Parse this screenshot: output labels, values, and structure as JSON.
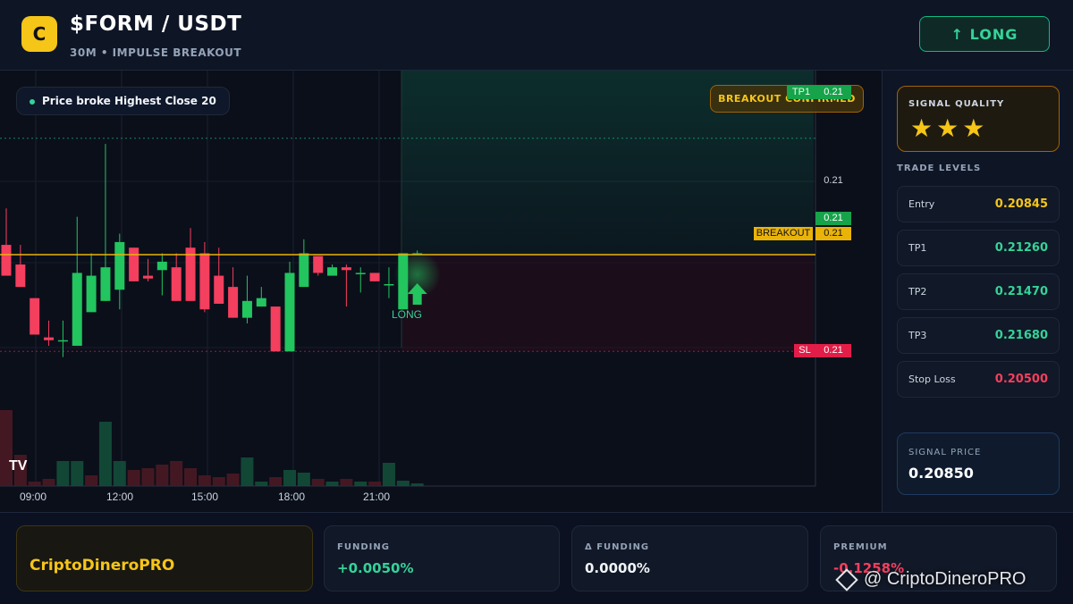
{
  "header": {
    "logo_letter": "C",
    "pair": "$FORM / USDT",
    "subtitle": "30M • IMPULSE BREAKOUT",
    "long_button": "↑ LONG"
  },
  "chart": {
    "price_badge": "Price broke Highest Close 20",
    "breakout_confirmed": "BREAKOUT CONFIRMED",
    "tp1_tag": "TP1",
    "tp1_value": "0.21",
    "axis_price": "0.21",
    "current_price_tag": "0.21",
    "breakout_tag": "BREAKOUT",
    "breakout_value": "0.21",
    "sl_tag": "SL",
    "sl_value": "0.21",
    "long_marker": "LONG",
    "tv_logo": "TV",
    "x_labels": [
      "09:00",
      "12:00",
      "15:00",
      "18:00",
      "21:00"
    ],
    "colors": {
      "up": "#22c55e",
      "down": "#f43f5e",
      "breakout": "#eab308"
    }
  },
  "panel": {
    "signal_quality_title": "SIGNAL QUALITY",
    "stars": "★★★",
    "trade_levels_title": "TRADE LEVELS",
    "levels": [
      {
        "label": "Entry",
        "value": "0.20845",
        "color": "#f5c518"
      },
      {
        "label": "TP1",
        "value": "0.21260",
        "color": "#34d399"
      },
      {
        "label": "TP2",
        "value": "0.21470",
        "color": "#34d399"
      },
      {
        "label": "TP3",
        "value": "0.21680",
        "color": "#34d399"
      },
      {
        "label": "Stop Loss",
        "value": "0.20500",
        "color": "#f43f5e"
      }
    ],
    "signal_price_title": "SIGNAL PRICE",
    "signal_price": "0.20850"
  },
  "footer": {
    "brand": "CriptoDineroPRO",
    "funding_label": "FUNDING",
    "funding_value": "+0.0050%",
    "delta_funding_label": "Δ FUNDING",
    "delta_funding_value": "0.0000%",
    "premium_label": "PREMIUM",
    "premium_value": "-0.1258%",
    "watermark": "@ CriptoDineroPRO"
  },
  "chart_data": {
    "type": "candlestick",
    "price_range": [
      0.2045,
      0.2139
    ],
    "levels": {
      "tp1": 0.2126,
      "breakout": 0.20845,
      "sl": 0.205
    },
    "candles": [
      {
        "o": 0.2088,
        "h": 0.2101,
        "l": 0.2078,
        "c": 0.2077
      },
      {
        "o": 0.2081,
        "h": 0.2088,
        "l": 0.2073,
        "c": 0.2073
      },
      {
        "o": 0.2069,
        "h": 0.2069,
        "l": 0.2057,
        "c": 0.2056
      },
      {
        "o": 0.2055,
        "h": 0.2061,
        "l": 0.2052,
        "c": 0.2054
      },
      {
        "o": 0.2054,
        "h": 0.2061,
        "l": 0.2048,
        "c": 0.2054
      },
      {
        "o": 0.2052,
        "h": 0.2098,
        "l": 0.2052,
        "c": 0.2078
      },
      {
        "o": 0.2064,
        "h": 0.2085,
        "l": 0.2064,
        "c": 0.2077
      },
      {
        "o": 0.2068,
        "h": 0.2124,
        "l": 0.2068,
        "c": 0.208
      },
      {
        "o": 0.2072,
        "h": 0.2092,
        "l": 0.2065,
        "c": 0.2089
      },
      {
        "o": 0.2087,
        "h": 0.2087,
        "l": 0.2075,
        "c": 0.2075
      },
      {
        "o": 0.2077,
        "h": 0.2083,
        "l": 0.2075,
        "c": 0.2076
      },
      {
        "o": 0.2079,
        "h": 0.2085,
        "l": 0.207,
        "c": 0.2082
      },
      {
        "o": 0.208,
        "h": 0.2085,
        "l": 0.2068,
        "c": 0.2068
      },
      {
        "o": 0.2087,
        "h": 0.2094,
        "l": 0.2068,
        "c": 0.2068
      },
      {
        "o": 0.2085,
        "h": 0.2089,
        "l": 0.2064,
        "c": 0.2065
      },
      {
        "o": 0.2077,
        "h": 0.2087,
        "l": 0.2067,
        "c": 0.2067
      },
      {
        "o": 0.2073,
        "h": 0.208,
        "l": 0.2062,
        "c": 0.2062
      },
      {
        "o": 0.2062,
        "h": 0.2077,
        "l": 0.206,
        "c": 0.2068
      },
      {
        "o": 0.2066,
        "h": 0.2073,
        "l": 0.2066,
        "c": 0.2069
      },
      {
        "o": 0.2066,
        "h": 0.2066,
        "l": 0.205,
        "c": 0.205
      },
      {
        "o": 0.205,
        "h": 0.2082,
        "l": 0.205,
        "c": 0.2078
      },
      {
        "o": 0.2073,
        "h": 0.209,
        "l": 0.2073,
        "c": 0.2085
      },
      {
        "o": 0.2084,
        "h": 0.2084,
        "l": 0.2077,
        "c": 0.2078
      },
      {
        "o": 0.2077,
        "h": 0.2081,
        "l": 0.2077,
        "c": 0.208
      },
      {
        "o": 0.208,
        "h": 0.2081,
        "l": 0.2066,
        "c": 0.2079
      },
      {
        "o": 0.2078,
        "h": 0.208,
        "l": 0.2071,
        "c": 0.2078
      },
      {
        "o": 0.2078,
        "h": 0.2078,
        "l": 0.2075,
        "c": 0.2075
      },
      {
        "o": 0.2074,
        "h": 0.208,
        "l": 0.2069,
        "c": 0.2074
      },
      {
        "o": 0.2065,
        "h": 0.2085,
        "l": 0.2065,
        "c": 0.2085
      },
      {
        "o": 0.2085,
        "h": 0.2086,
        "l": 0.2085,
        "c": 0.2085
      }
    ],
    "volumes": [
      {
        "v": 0.85,
        "up": false
      },
      {
        "v": 0.35,
        "up": false
      },
      {
        "v": 0.05,
        "up": false
      },
      {
        "v": 0.08,
        "up": false
      },
      {
        "v": 0.28,
        "up": true
      },
      {
        "v": 0.28,
        "up": true
      },
      {
        "v": 0.12,
        "up": false
      },
      {
        "v": 0.72,
        "up": true
      },
      {
        "v": 0.28,
        "up": true
      },
      {
        "v": 0.18,
        "up": false
      },
      {
        "v": 0.2,
        "up": false
      },
      {
        "v": 0.24,
        "up": false
      },
      {
        "v": 0.28,
        "up": false
      },
      {
        "v": 0.2,
        "up": false
      },
      {
        "v": 0.12,
        "up": false
      },
      {
        "v": 0.1,
        "up": false
      },
      {
        "v": 0.14,
        "up": false
      },
      {
        "v": 0.32,
        "up": true
      },
      {
        "v": 0.05,
        "up": true
      },
      {
        "v": 0.1,
        "up": false
      },
      {
        "v": 0.18,
        "up": true
      },
      {
        "v": 0.15,
        "up": true
      },
      {
        "v": 0.08,
        "up": false
      },
      {
        "v": 0.05,
        "up": true
      },
      {
        "v": 0.08,
        "up": false
      },
      {
        "v": 0.05,
        "up": true
      },
      {
        "v": 0.05,
        "up": false
      },
      {
        "v": 0.26,
        "up": true
      },
      {
        "v": 0.06,
        "up": true
      },
      {
        "v": 0.03,
        "up": true
      }
    ]
  }
}
